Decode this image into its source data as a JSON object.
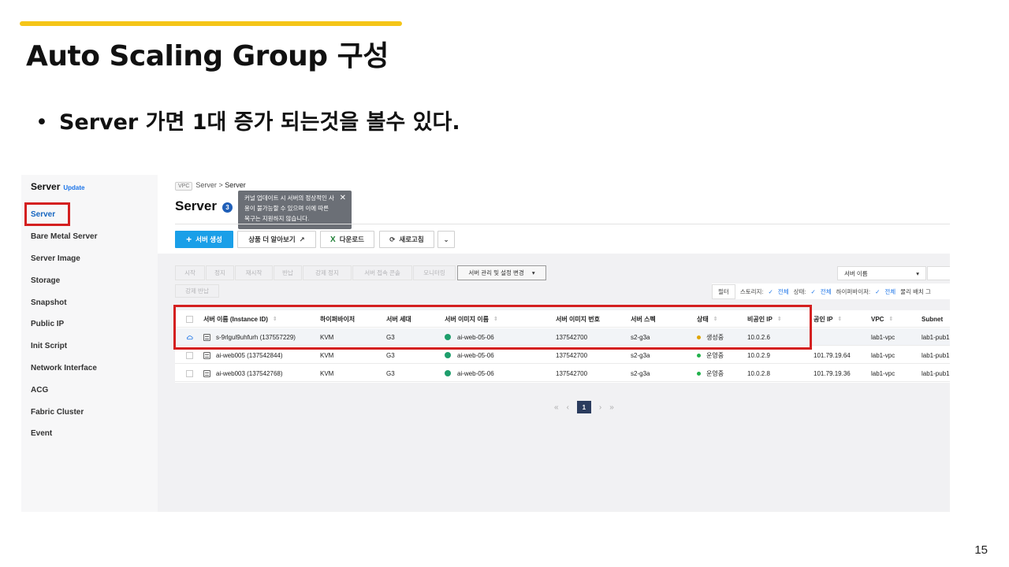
{
  "slide": {
    "title": "Auto Scaling Group 구성",
    "bullet": "Server 가면 1대 증가 되는것을 볼수 있다.",
    "page_number": "15",
    "accent_color": "#f5c518"
  },
  "sidebar": {
    "title": "Server",
    "badge": "Update",
    "items": [
      {
        "label": "Server",
        "active": true
      },
      {
        "label": "Bare Metal Server"
      },
      {
        "label": "Server Image"
      },
      {
        "label": "Storage"
      },
      {
        "label": "Snapshot"
      },
      {
        "label": "Public IP"
      },
      {
        "label": "Init Script"
      },
      {
        "label": "Network Interface"
      },
      {
        "label": "ACG"
      },
      {
        "label": "Fabric Cluster"
      },
      {
        "label": "Event"
      }
    ]
  },
  "breadcrumb": {
    "tag": "VPC",
    "parent": "Server",
    "sep": ">",
    "current": "Server"
  },
  "page": {
    "title": "Server",
    "count": "3",
    "tooltip": "커널 업데이트 시 서버의 정상적인 사용이 불가능할 수 있으며 이에 따른 복구는 지원하지 않습니다.",
    "close": "✕"
  },
  "toolbar": {
    "create": "서버 생성",
    "more": "상품 더 알아보기",
    "download": "다운로드",
    "refresh": "새로고침",
    "more_menu": "⌄"
  },
  "actions": {
    "start": "시작",
    "stop": "정지",
    "restart": "재시작",
    "return": "반납",
    "force_stop": "강제 정지",
    "console": "서버 접속 콘솔",
    "monitoring": "모니터링",
    "manage": "서버 관리 및 설정 변경",
    "force_return": "강제 반납",
    "search_select": "서버 이름"
  },
  "filter": {
    "button": "필터",
    "storage_label": "스토리지:",
    "storage_value": "전체",
    "status_label": "상태:",
    "status_value": "전체",
    "hypervisor_label": "하이퍼바이저:",
    "hypervisor_value": "전체",
    "placement": "물리 배치 그"
  },
  "table": {
    "columns": [
      "서버 이름 (Instance ID)",
      "하이퍼바이저",
      "서버 세대",
      "서버 이미지 이름",
      "서버 이미지 번호",
      "서버 스펙",
      "상태",
      "비공인 IP",
      "공인 IP",
      "VPC",
      "Subnet"
    ],
    "rows": [
      {
        "name": "s-9rlgul9uhfurh (137557229)",
        "hypervisor": "KVM",
        "gen": "G3",
        "image": "ai-web-05-06",
        "image_no": "137542700",
        "spec": "s2-g3a",
        "status": "생성중",
        "status_color": "#e0a500",
        "private_ip": "10.0.2.6",
        "public_ip": "",
        "vpc": "lab1-vpc",
        "subnet": "lab1-pub1",
        "selected": true
      },
      {
        "name": "ai-web005 (137542844)",
        "hypervisor": "KVM",
        "gen": "G3",
        "image": "ai-web-05-06",
        "image_no": "137542700",
        "spec": "s2-g3a",
        "status": "운영중",
        "status_color": "#22b14c",
        "private_ip": "10.0.2.9",
        "public_ip": "101.79.19.64",
        "vpc": "lab1-vpc",
        "subnet": "lab1-pub1"
      },
      {
        "name": "ai-web003 (137542768)",
        "hypervisor": "KVM",
        "gen": "G3",
        "image": "ai-web-05-06",
        "image_no": "137542700",
        "spec": "s2-g3a",
        "status": "운영중",
        "status_color": "#22b14c",
        "private_ip": "10.0.2.8",
        "public_ip": "101.79.19.36",
        "vpc": "lab1-vpc",
        "subnet": "lab1-pub1"
      }
    ]
  },
  "pagination": {
    "first": "«",
    "prev": "‹",
    "current": "1",
    "next": "›",
    "last": "»"
  }
}
